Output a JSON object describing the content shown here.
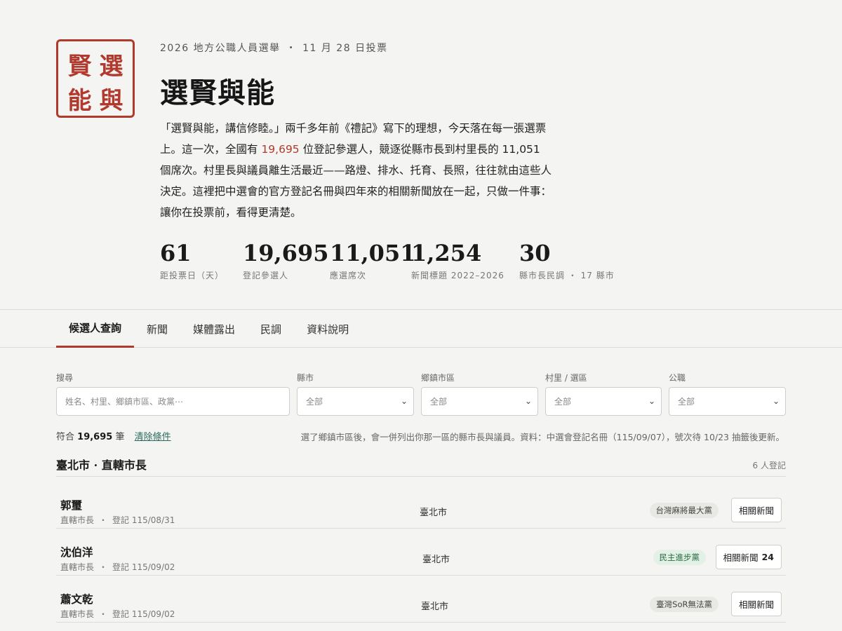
{
  "logo": {
    "chars": [
      "選",
      "賢",
      "與",
      "能"
    ]
  },
  "header": {
    "election": "2026 地方公職人員選舉",
    "vote_date": "11 月 28 日投票",
    "title": "選賢與能",
    "intro_1": "「選賢與能，講信修睦。」兩千多年前《禮記》寫下的理想，今天落在每一張選票上。這一次，全國有 ",
    "intro_hl": "19,695",
    "intro_2": " 位登記參選人，競逐從縣市長到村里長的 11,051 個席次。村里長與議員離生活最近——路燈、排水、托育、長照，往往就由這些人決定。這裡把中選會的官方登記名冊與四年來的相關新聞放在一起，只做一件事：讓你在投票前，看得更清楚。"
  },
  "stats": [
    {
      "value": "61",
      "label": "距投票日（天）"
    },
    {
      "value": "19,695",
      "label": "登記參選人"
    },
    {
      "value": "11,051",
      "label": "應選席次"
    },
    {
      "value": "1,254",
      "label": "新聞標題 2022–2026"
    },
    {
      "value": "30",
      "label": "縣市長民調 ・ 17 縣市"
    }
  ],
  "tabs": [
    "候選人查詢",
    "新聞",
    "媒體露出",
    "民調",
    "資料說明"
  ],
  "filters": {
    "search_label": "搜尋",
    "search_placeholder": "姓名、村里、鄉鎮市區、政黨⋯",
    "county_label": "縣市",
    "county_value": "全部",
    "township_label": "鄉鎮市區",
    "township_value": "全部",
    "village_label": "村里 / 選區",
    "village_value": "全部",
    "office_label": "公職",
    "office_value": "全部"
  },
  "summary": {
    "prefix": "符合",
    "count": "19,695",
    "suffix": "筆",
    "clear": "清除條件",
    "note": "選了鄉鎮市區後，會一併列出你那一區的縣市長與議員。資料：中選會登記名冊（115/09/07），號次待 10/23 抽籤後更新。"
  },
  "group": {
    "title": "臺北市 · 直轄市長",
    "count": "6 人登記"
  },
  "candidates": [
    {
      "name": "郭璽",
      "office": "直轄市長",
      "registered": "登記 115/08/31",
      "city": "臺北市",
      "party": "台灣麻將最大黨",
      "party_color": "grey",
      "news_label": "相關新聞",
      "news_count": ""
    },
    {
      "name": "沈伯洋",
      "office": "直轄市長",
      "registered": "登記 115/09/02",
      "city": "臺北市",
      "party": "民主進步黨",
      "party_color": "green",
      "news_label": "相關新聞",
      "news_count": "24"
    },
    {
      "name": "蕭文乾",
      "office": "直轄市長",
      "registered": "登記 115/09/02",
      "city": "臺北市",
      "party": "臺灣SoR無法黨",
      "party_color": "grey",
      "news_label": "相關新聞",
      "news_count": ""
    }
  ],
  "colors": {
    "accent": "#b03a2e",
    "link": "#2a6b5c",
    "dpp_badge": "#e2f0e6"
  }
}
